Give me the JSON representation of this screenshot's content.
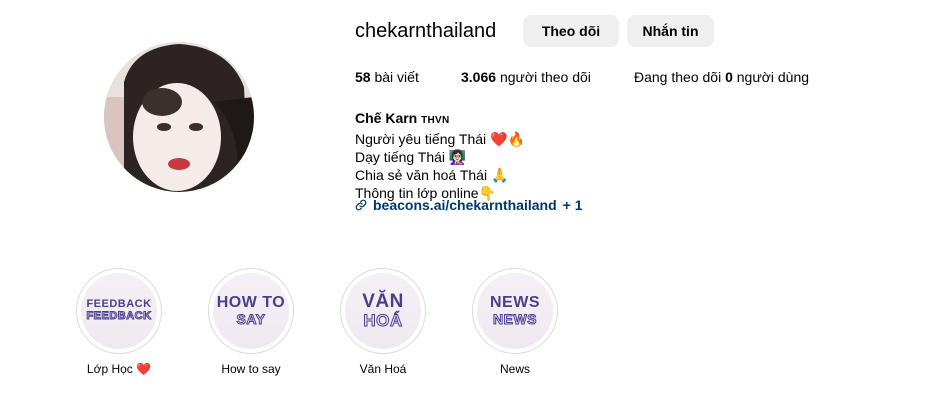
{
  "profile": {
    "username": "chekarnthailand",
    "follow_label": "Theo dõi",
    "message_label": "Nhắn tin"
  },
  "stats": {
    "posts_count": "58",
    "posts_label": "bài viết",
    "followers_count": "3.066",
    "followers_label": "người theo dõi",
    "following_prefix": "Đang theo dõi",
    "following_count": "0",
    "following_label": "người dùng"
  },
  "bio": {
    "name": "Chế Karn",
    "name_tag": "THVN",
    "lines": [
      "Người yêu tiếng Thái ❤️🔥",
      "Dạy tiếng Thái 👩🏻‍🏫",
      "Chia sẻ văn hoá Thái 🙏",
      "Thông tin lớp online👇"
    ],
    "link_text": "beacons.ai/chekarnthailand",
    "link_extra": "+ 1"
  },
  "highlights": [
    {
      "title_1": "FEEDBACK",
      "title_2": "FEEDBACK",
      "label": "Lớp Học ❤️"
    },
    {
      "title_1": "HOW TO",
      "title_2": "SAY",
      "label": "How to say"
    },
    {
      "title_1": "VĂN",
      "title_2": "HOÁ",
      "label": "Văn Hoá"
    },
    {
      "title_1": "NEWS",
      "title_2": "NEWS",
      "label": "News"
    }
  ],
  "colors": {
    "button_bg": "#efefef",
    "link": "#00376b",
    "highlight_text": "#4a3f8c"
  },
  "icons": {
    "avatar": "profile-photo",
    "link": "link-icon"
  }
}
